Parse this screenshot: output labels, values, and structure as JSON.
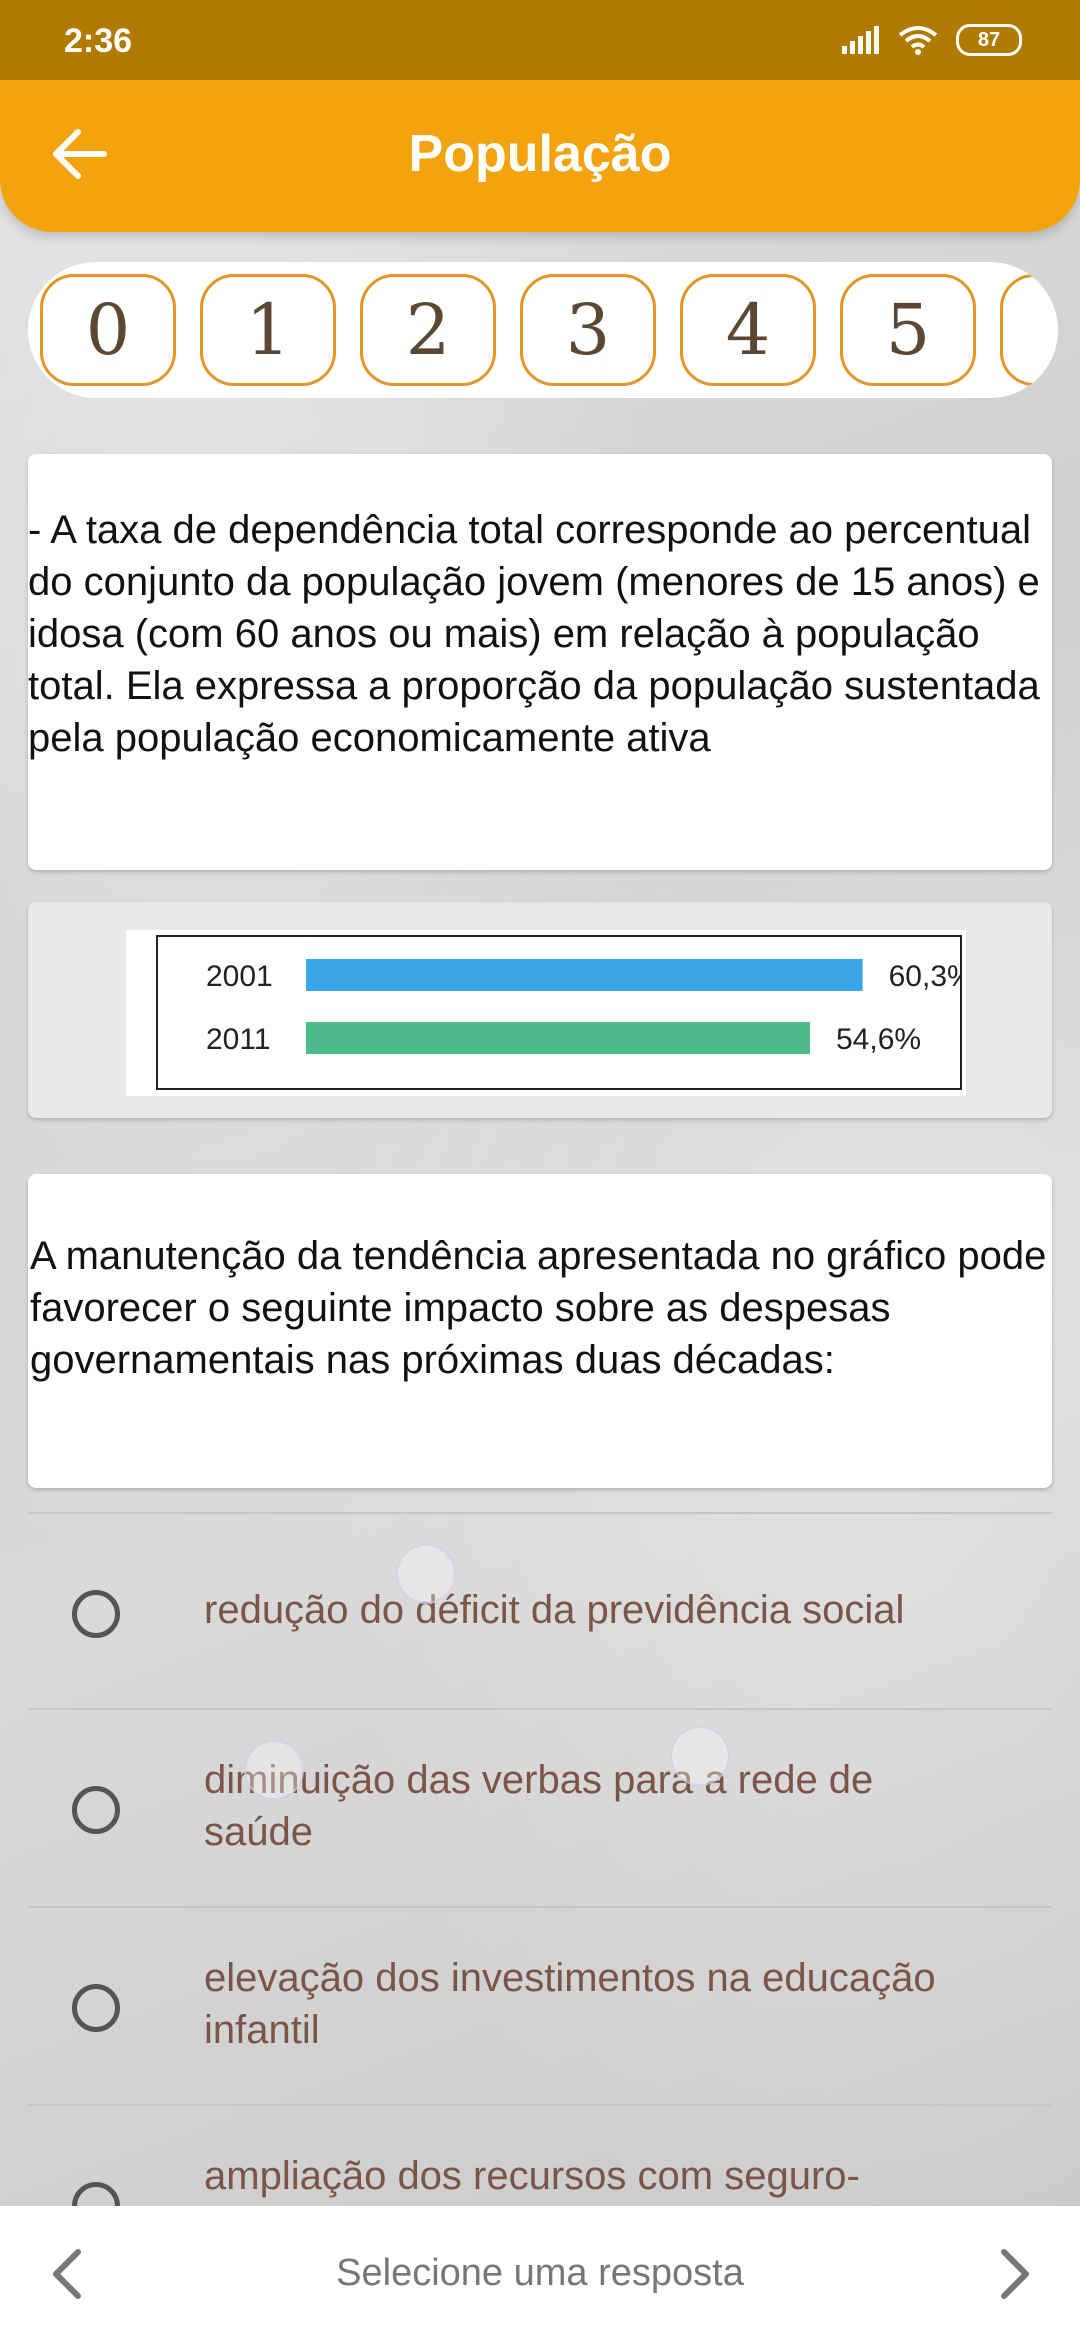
{
  "status_bar": {
    "time": "2:36",
    "battery": "87"
  },
  "app_bar": {
    "title": "População"
  },
  "question_numbers": [
    "0",
    "1",
    "2",
    "3",
    "4",
    "5"
  ],
  "statement": "- A taxa de dependência total corresponde ao percentual do conjunto da população jovem (menores de 15 anos) e idosa (com 60 anos ou mais) em relação à população total. Ela expressa a proporção da população sustentada pela população economicamente ativa",
  "chart_data": {
    "type": "bar",
    "orientation": "horizontal",
    "categories": [
      "2001",
      "2011"
    ],
    "values": [
      60.3,
      54.6
    ],
    "value_labels": [
      "60,3%",
      "54,6%"
    ],
    "colors": [
      "#3aa6e6",
      "#4dbb8a"
    ],
    "xlim": [
      0,
      65
    ]
  },
  "question": "A manutenção da tendência apresentada no gráfico pode favorecer o seguinte impacto sobre as despesas governamentais nas próximas duas décadas:",
  "options": [
    "redução do déficit da previdência social",
    "diminuição das verbas para a rede de saúde",
    "elevação dos investimentos na educação infantil",
    "ampliação dos recursos com seguro-"
  ],
  "bottom_bar": {
    "hint": "Selecione uma resposta"
  }
}
